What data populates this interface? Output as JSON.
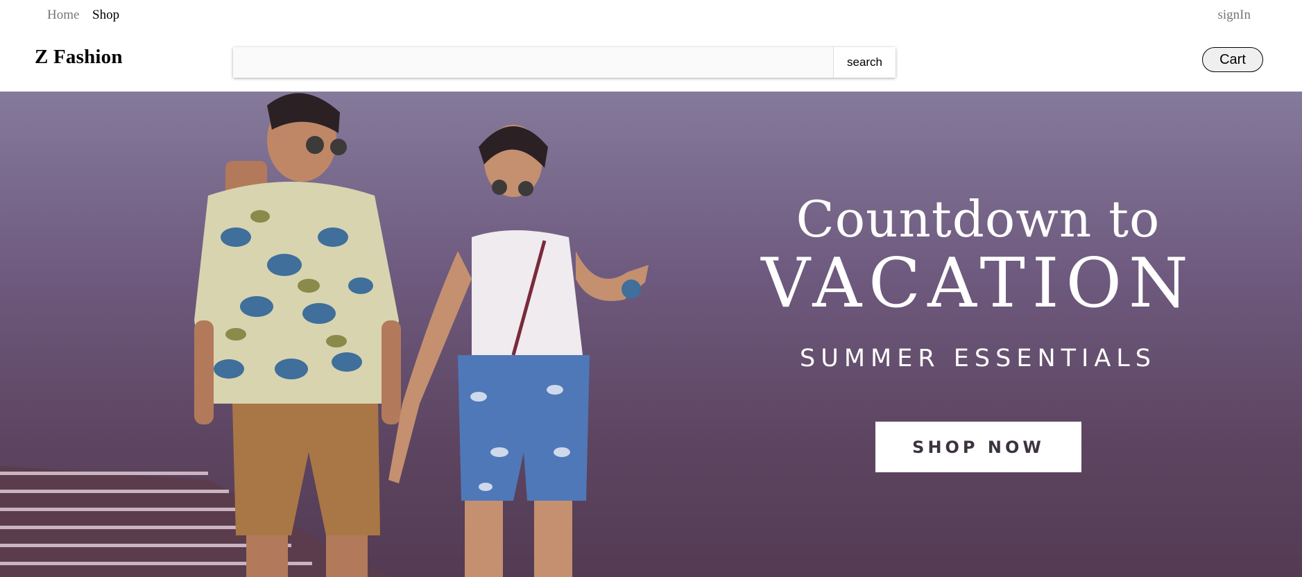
{
  "topnav": {
    "home_label": "Home",
    "shop_label": "Shop",
    "signin_label": "signIn"
  },
  "header": {
    "brand": "Z Fashion",
    "search": {
      "value": "",
      "placeholder": "",
      "button_label": "search"
    },
    "cart_label": "Cart"
  },
  "hero": {
    "line1": "Countdown to",
    "line2": "VACATION",
    "line3": "SUMMER ESSENTIALS",
    "cta_label": "SHOP NOW"
  },
  "colors": {
    "hero_background": "#6e5a7e",
    "nav_muted": "#777777",
    "cta_text": "#3c3340"
  }
}
